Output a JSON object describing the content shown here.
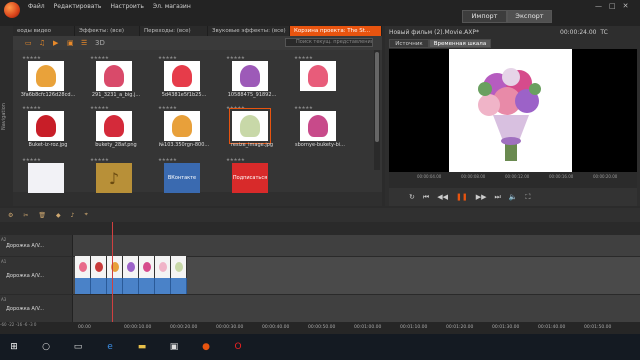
{
  "menu": {
    "file": "Файл",
    "edit": "Редактировать",
    "setup": "Настроить",
    "shop": "Эл. магазин"
  },
  "main_tabs": {
    "import": "Импорт",
    "export": "Экспорт"
  },
  "library_tabs": [
    "еоды видео",
    "Эффекты: (все)",
    "Переходы: (все)",
    "Звуковые эффекты: (все)",
    "Корзина проекта: The St..."
  ],
  "nav_label": "Navigation",
  "search_placeholder": "Поиск текущ. представления",
  "thumbnails": [
    {
      "caption": "3fa6b8cfc126d28cd...",
      "color": "#e9a23a"
    },
    {
      "caption": "291_3231_a_big.j...",
      "color": "#d94a6a"
    },
    {
      "caption": "5d4381e5f1b25...",
      "color": "#e63c4a"
    },
    {
      "caption": "10588475_91892...",
      "color": "#9d5ab8"
    },
    {
      "caption": "",
      "color": "#e85c7a"
    },
    {
      "caption": "Buket-iz-roz.jpg",
      "color": "#c81e28"
    },
    {
      "caption": "bukety_28af.png",
      "color": "#d42a3a"
    },
    {
      "caption": "№103.350rgn-800...",
      "color": "#e8a03a"
    },
    {
      "caption": "resize_image.jpg",
      "color": "#c8d8a8"
    },
    {
      "caption": "sbornye-bukety-bi...",
      "color": "#c84a8a"
    },
    {
      "caption": "",
      "color": "#f2f2f6"
    },
    {
      "caption": "",
      "color": "#b89038"
    },
    {
      "caption": "",
      "color": "#3a6ab0"
    },
    {
      "caption": "",
      "color": "#d82a2a"
    }
  ],
  "badges": {
    "vk": "ВКонтакте",
    "subscribe": "Подписаться"
  },
  "player": {
    "title": "Новый фильм (2).Movie.AXP*",
    "time": "00:00:24.00",
    "tc": "TC",
    "tab_source": "Источник",
    "tab_timeline": "Временная шкала"
  },
  "ruler_marks": [
    "00:00:04.00",
    "00:00:08.00",
    "00:00:12.00",
    "00:00:16.00",
    "00:00:20.00"
  ],
  "tracks": [
    {
      "num": "A2",
      "name": "Дорожка A/V..."
    },
    {
      "num": "A1",
      "name": "Дорожка A/V..."
    },
    {
      "num": "A3",
      "name": "Дорожка A/V..."
    }
  ],
  "timeline_marks": [
    "00.00",
    "00:00:10.00",
    "00:00:20.00",
    "00:00:30.00",
    "00:00:40.00",
    "00:00:50.00",
    "00:01:00.00",
    "00:01:10.00",
    "00:01:20.00",
    "00:01:30.00",
    "00:01:40.00",
    "00:01:50.00"
  ],
  "level_marks": "-60 -22 -16 -6 -3 0",
  "colors": {
    "accent": "#e8540f",
    "clip_audio": "#4a82c8",
    "playhead": "#d04040"
  }
}
